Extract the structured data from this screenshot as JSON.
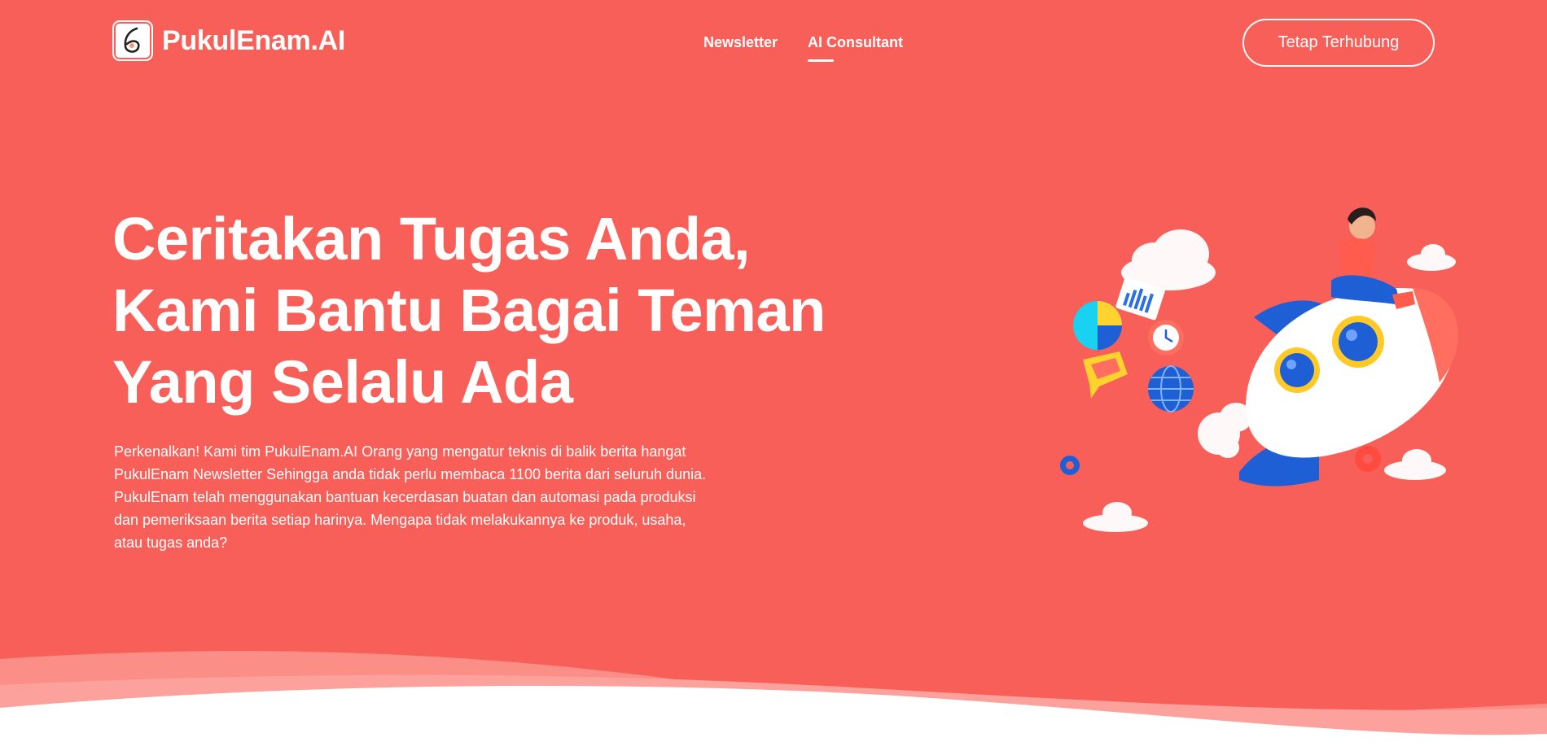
{
  "header": {
    "logo_text": "PukulEnam.AI",
    "logo_icon": "number-six-clock-icon",
    "nav": [
      {
        "label": "Newsletter",
        "active": false
      },
      {
        "label": "AI Consultant",
        "active": true
      }
    ],
    "cta_label": "Tetap Terhubung"
  },
  "hero": {
    "headline": [
      "Ceritakan Tugas Anda,",
      "Kami Bantu Bagai Teman",
      "Yang Selalu Ada"
    ],
    "intro": "Perkenalkan! Kami tim PukulEnam.AI Orang yang mengatur teknis di balik berita hangat PukulEnam Newsletter Sehingga anda tidak perlu membaca 1100 berita dari seluruh dunia. PukulEnam telah menggunakan bantuan kecerdasan buatan dan automasi pada produksi dan pemeriksaan berita setiap harinya. Mengapa tidak melakukannya ke produk, usaha, atau tugas anda?",
    "illustration": "rocket-with-girl-illustration"
  },
  "colors": {
    "background": "#f75f58",
    "text": "#ffffff",
    "rocket_blue": "#1f5fd6",
    "rocket_body": "#ffffff"
  }
}
